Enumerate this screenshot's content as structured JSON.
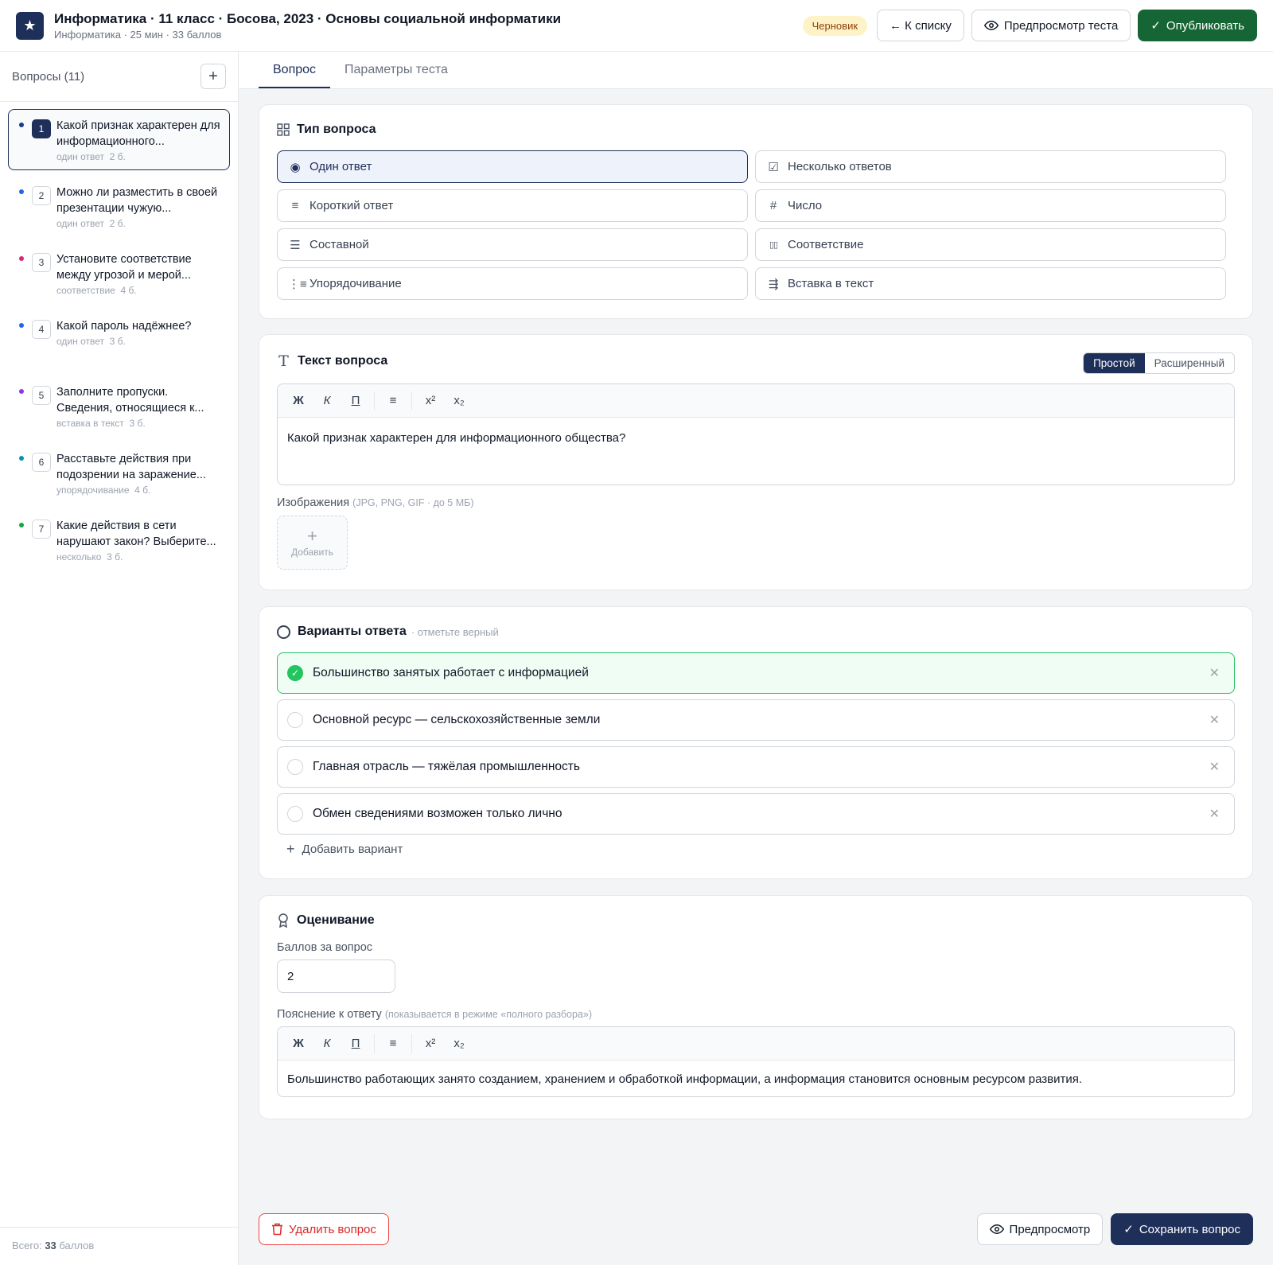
{
  "header": {
    "logo_icon": "star-icon",
    "title": "Информатика · 11 класс · Босова, 2023 · Основы социальной информатики",
    "subtitle": "Информатика · 25 мин · 33 баллов",
    "status_badge": "Черновик",
    "back_label": "← К списку",
    "preview_test_label": "Предпросмотр теста",
    "publish_label": "Опубликовать"
  },
  "sidebar": {
    "title": "Вопросы (11)",
    "add_label": "+",
    "items": [
      {
        "num": "1",
        "text": "Какой признак характерен для информационного...",
        "type": "один ответ",
        "points": "2 б.",
        "dot": "#1e3a8a"
      },
      {
        "num": "2",
        "text": "Можно ли разместить в своей презентации чужую...",
        "type": "один ответ",
        "points": "2 б.",
        "dot": "#2563eb"
      },
      {
        "num": "3",
        "text": "Установите соответствие между угрозой и мерой...",
        "type": "соответствие",
        "points": "4 б.",
        "dot": "#db2777"
      },
      {
        "num": "4",
        "text": "Какой пароль надёжнее?",
        "type": "один ответ",
        "points": "3 б.",
        "dot": "#2563eb"
      },
      {
        "num": "5",
        "text": "Заполните пропуски. Сведения, относящиеся к...",
        "type": "вставка в текст",
        "points": "3 б.",
        "dot": "#9333ea"
      },
      {
        "num": "6",
        "text": "Расставьте действия при подозрении на заражение...",
        "type": "упорядочивание",
        "points": "4 б.",
        "dot": "#0891b2"
      },
      {
        "num": "7",
        "text": "Какие действия в сети нарушают закон? Выберите...",
        "type": "несколько",
        "points": "3 б.",
        "dot": "#16a34a"
      }
    ],
    "footer_prefix": "Всего: ",
    "footer_value": "33",
    "footer_suffix": " баллов"
  },
  "tabs": [
    "Вопрос",
    "Параметры теста"
  ],
  "question_type": {
    "title": "Тип вопроса",
    "options": [
      {
        "label": "Один ответ",
        "icon": "radio-icon",
        "selected": true
      },
      {
        "label": "Несколько ответов",
        "icon": "checkbox-icon",
        "selected": false
      },
      {
        "label": "Короткий ответ",
        "icon": "text-lines-icon",
        "selected": false
      },
      {
        "label": "Число",
        "icon": "hash-icon",
        "selected": false
      },
      {
        "label": "Составной",
        "icon": "list-icon",
        "selected": false
      },
      {
        "label": "Соответствие",
        "icon": "columns-icon",
        "selected": false
      },
      {
        "label": "Упорядочивание",
        "icon": "ordered-list-icon",
        "selected": false
      },
      {
        "label": "Вставка в текст",
        "icon": "text-insert-icon",
        "selected": false
      }
    ]
  },
  "question_text": {
    "title": "Текст вопроса",
    "mode_simple": "Простой",
    "mode_advanced": "Расширенный",
    "toolbar": {
      "bold": "Ж",
      "italic": "К",
      "underline": "П",
      "list": "≡",
      "sup": "x²",
      "sub": "x₂"
    },
    "value": "Какой признак характерен для информационного общества?",
    "images_label": "Изображения",
    "images_hint": "(JPG, PNG, GIF · до 5 МБ)",
    "add_image": "Добавить"
  },
  "answers": {
    "title": "Варианты ответа",
    "hint": "· отметьте верный",
    "items": [
      {
        "text": "Большинство занятых работает с информацией",
        "correct": true
      },
      {
        "text": "Основной ресурс — сельскохозяйственные земли",
        "correct": false
      },
      {
        "text": "Главная отрасль — тяжёлая промышленность",
        "correct": false
      },
      {
        "text": "Обмен сведениями возможен только лично",
        "correct": false
      }
    ],
    "add_label": "Добавить вариант"
  },
  "grading": {
    "title": "Оценивание",
    "points_label": "Баллов за вопрос",
    "points_value": "2",
    "explanation_label": "Пояснение к ответу",
    "explanation_hint": "(показывается в режиме «полного разбора»)",
    "explanation_value": "Большинство работающих занято созданием, хранением и обработкой информации, а информация становится основным ресурсом развития."
  },
  "footer": {
    "delete_label": "Удалить вопрос",
    "preview_label": "Предпросмотр",
    "save_label": "Сохранить вопрос"
  },
  "colors": {
    "brand": "#1e2f5a",
    "publish": "#166534",
    "correct": "#22c55e",
    "danger": "#dc2626"
  }
}
